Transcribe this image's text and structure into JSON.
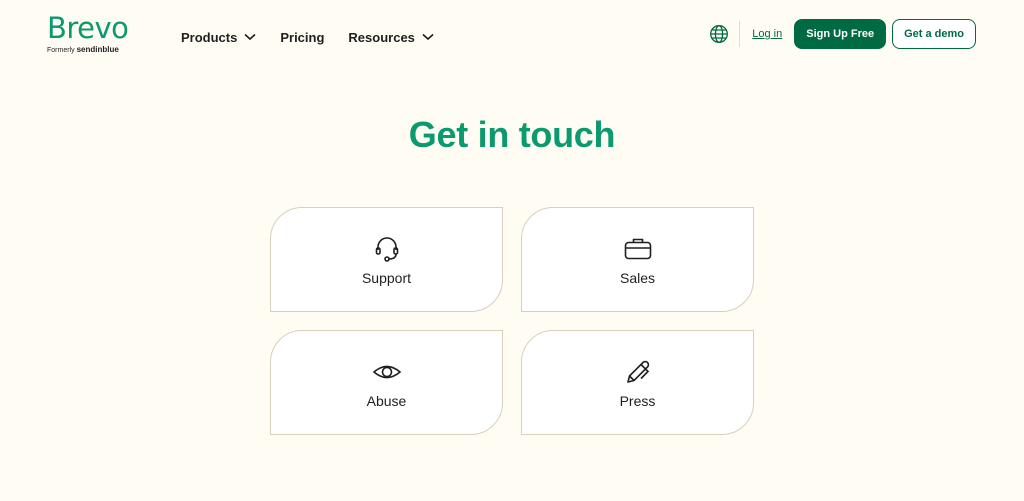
{
  "brand": {
    "name": "Brevo",
    "formerly_prefix": "Formerly",
    "formerly_name": "sendinblue",
    "color": "#0b996e"
  },
  "nav": {
    "items": [
      {
        "label": "Products",
        "has_dropdown": true
      },
      {
        "label": "Pricing",
        "has_dropdown": false
      },
      {
        "label": "Resources",
        "has_dropdown": true
      }
    ]
  },
  "header_actions": {
    "language_icon": "globe-icon",
    "login_label": "Log in",
    "signup_label": "Sign Up Free",
    "demo_label": "Get a demo",
    "primary_color": "#006a43"
  },
  "page": {
    "title": "Get in touch"
  },
  "contact_cards": [
    {
      "label": "Support",
      "icon": "headset-icon"
    },
    {
      "label": "Sales",
      "icon": "briefcase-icon"
    },
    {
      "label": "Abuse",
      "icon": "eye-icon"
    },
    {
      "label": "Press",
      "icon": "pencil-icon"
    }
  ]
}
